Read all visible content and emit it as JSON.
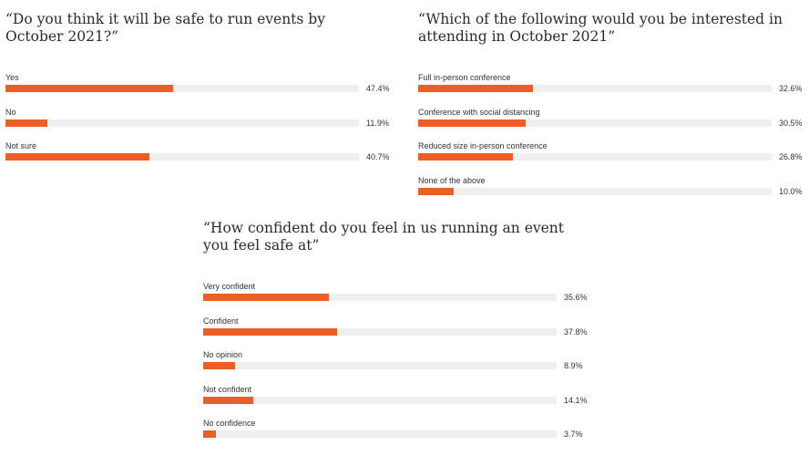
{
  "chart_data": [
    {
      "type": "bar",
      "orientation": "horizontal",
      "title": "“Do you think it will be safe to run events by October 2021?”",
      "categories": [
        "Yes",
        "No",
        "Not sure"
      ],
      "values": [
        47.4,
        11.9,
        40.7
      ],
      "value_labels": [
        "47.4%",
        "11.9%",
        "40.7%"
      ],
      "xlim": [
        0,
        100
      ],
      "grid": false
    },
    {
      "type": "bar",
      "orientation": "horizontal",
      "title": "“Which of the following would you be interested in attending in October 2021”",
      "categories": [
        "Full in-person conference",
        "Conference with social distancing",
        "Reduced size in-person conference",
        "None of the above"
      ],
      "values": [
        32.6,
        30.5,
        26.8,
        10.0
      ],
      "value_labels": [
        "32.6%",
        "30.5%",
        "26.8%",
        "10.0%"
      ],
      "xlim": [
        0,
        100
      ],
      "grid": false
    },
    {
      "type": "bar",
      "orientation": "horizontal",
      "title": "“How confident do you feel in us running an event you feel safe at”",
      "categories": [
        "Very confident",
        "Confident",
        "No opinion",
        "Not confident",
        "No confidence"
      ],
      "values": [
        35.6,
        37.8,
        8.9,
        14.1,
        3.7
      ],
      "value_labels": [
        "35.6%",
        "37.8%",
        "8.9%",
        "14.1%",
        "3.7%"
      ],
      "xlim": [
        0,
        100
      ],
      "grid": false
    }
  ],
  "colors": {
    "bar_fill": "#eb5f26",
    "bar_track": "#efefef"
  }
}
